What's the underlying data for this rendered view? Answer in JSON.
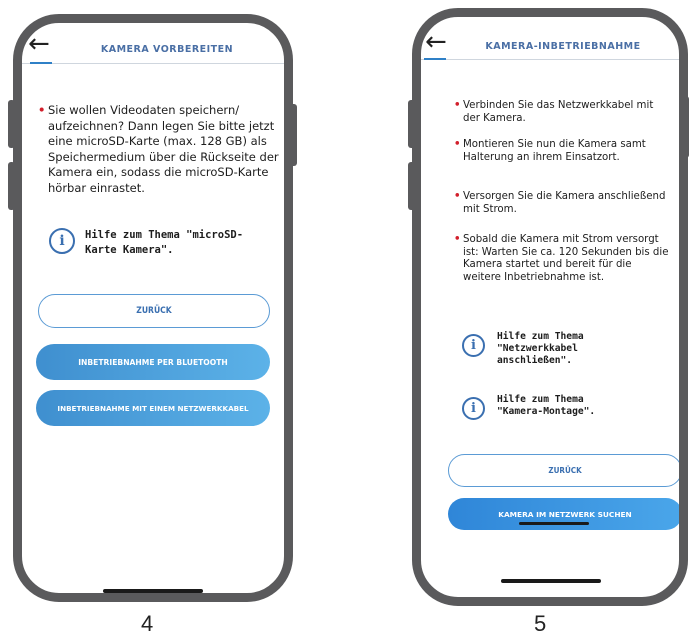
{
  "phone4": {
    "header_title": "KAMERA VORBEREITEN",
    "back_icon": "arrow-left",
    "bullet_text": "Sie wollen Videodaten speichern/ aufzeichnen? Dann legen Sie bitte jetzt eine microSD-Karte (max. 128 GB) als Speichermedium über die Rückseite der Kamera ein, sodass die microSD-Karte hörbar einrastet.",
    "help_text": "Hilfe zum Thema \"microSD-Karte Kamera\".",
    "btn_back": "ZURÜCK",
    "btn_bluetooth": "INBETRIEBNAHME PER BLUETOOTH",
    "btn_network": "INBETRIEBNAHME MIT EINEM NETZWERKKABEL",
    "caption": "4"
  },
  "phone5": {
    "header_title": "KAMERA-INBETRIEBNAHME",
    "back_icon": "arrow-left",
    "bullets": [
      "Verbinden Sie das Netzwerkkabel mit der Kamera.",
      "Montieren Sie nun die Kamera samt Halterung an ihrem Einsatzort.",
      "Versorgen Sie die Kamera anschließend mit Strom.",
      "Sobald die Kamera mit Strom versorgt ist: Warten Sie ca. 120 Sekunden bis die Kamera startet und bereit für die weitere Inbetriebnahme ist."
    ],
    "help1": "Hilfe zum Thema \"Netzwerkkabel anschließen\".",
    "help2": "Hilfe zum Thema \"Kamera-Montage\".",
    "btn_back": "ZURÜCK",
    "btn_search": "KAMERA IM NETZWERK SUCHEN",
    "caption": "5"
  },
  "colors": {
    "frame": "#5a5a5c",
    "accent": "#2f80c7",
    "bullet": "#d21f2b",
    "btn_gradient_start": "#3f8fcf",
    "btn_gradient_end": "#5cb2e8"
  }
}
